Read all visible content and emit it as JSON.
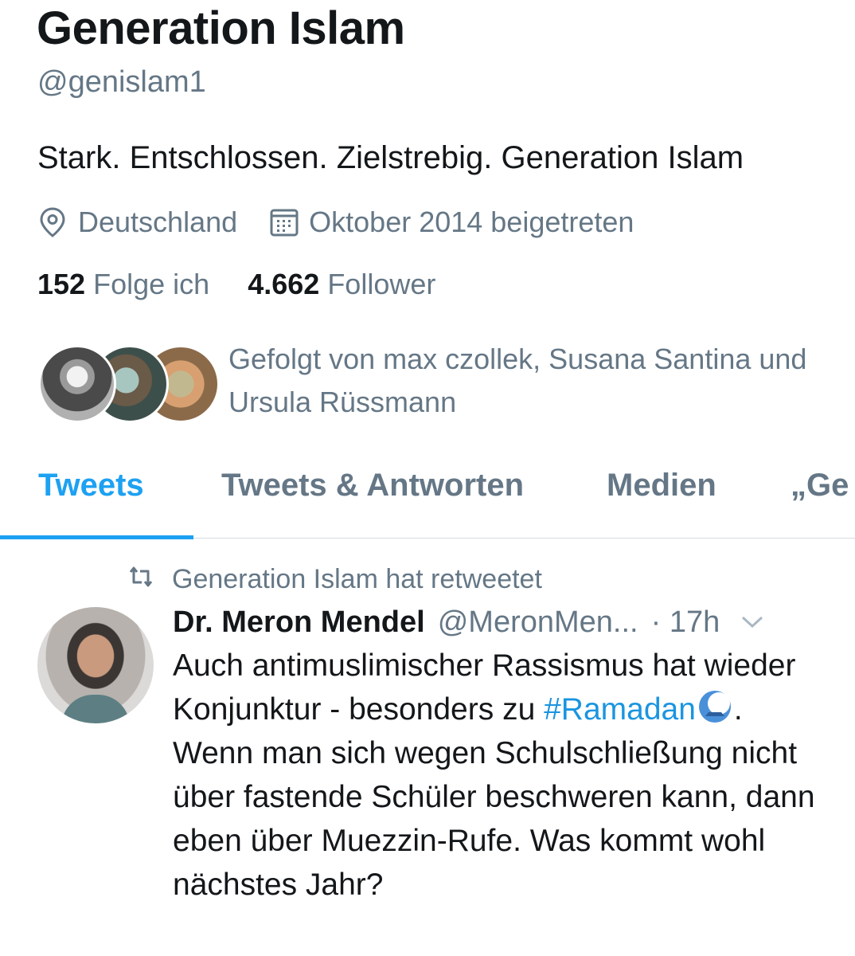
{
  "profile": {
    "name": "Generation Islam",
    "handle": "@genislam1",
    "bio": "Stark. Entschlossen. Zielstrebig. Generation Islam",
    "location": "Deutschland",
    "joined": "Oktober 2014 beigetreten",
    "following_count": "152",
    "following_label": "Folge ich",
    "followers_count": "4.662",
    "followers_label": "Follower",
    "followed_by": "Gefolgt von max czollek, Susana Santina und Ursula Rüssmann",
    "icons": {
      "location": "location-pin-icon",
      "joined": "calendar-icon"
    }
  },
  "tabs": [
    {
      "label": "Tweets",
      "active": true
    },
    {
      "label": "Tweets & Antworten",
      "active": false
    },
    {
      "label": "Medien",
      "active": false
    },
    {
      "label": "„Ge",
      "active": false
    }
  ],
  "tweet": {
    "retweet_label": "Generation Islam hat retweetet",
    "author_name": "Dr. Meron Mendel",
    "author_handle": "@MeronMen...",
    "time": "· 17h",
    "text_part1": "Auch antimuslimischer Rassismus hat wieder Konjunktur - besonders zu ",
    "hashtag": "#Ramadan",
    "text_part2": ". Wenn man sich wegen Schulschließung nicht über fastende Schüler beschweren kann, dann eben über Muezzin-Rufe. Was kommt wohl nächstes Jahr?"
  },
  "colors": {
    "accent": "#1da1f2",
    "text_primary": "#14171a",
    "text_secondary": "#657786",
    "divider": "#d6dbe0"
  }
}
